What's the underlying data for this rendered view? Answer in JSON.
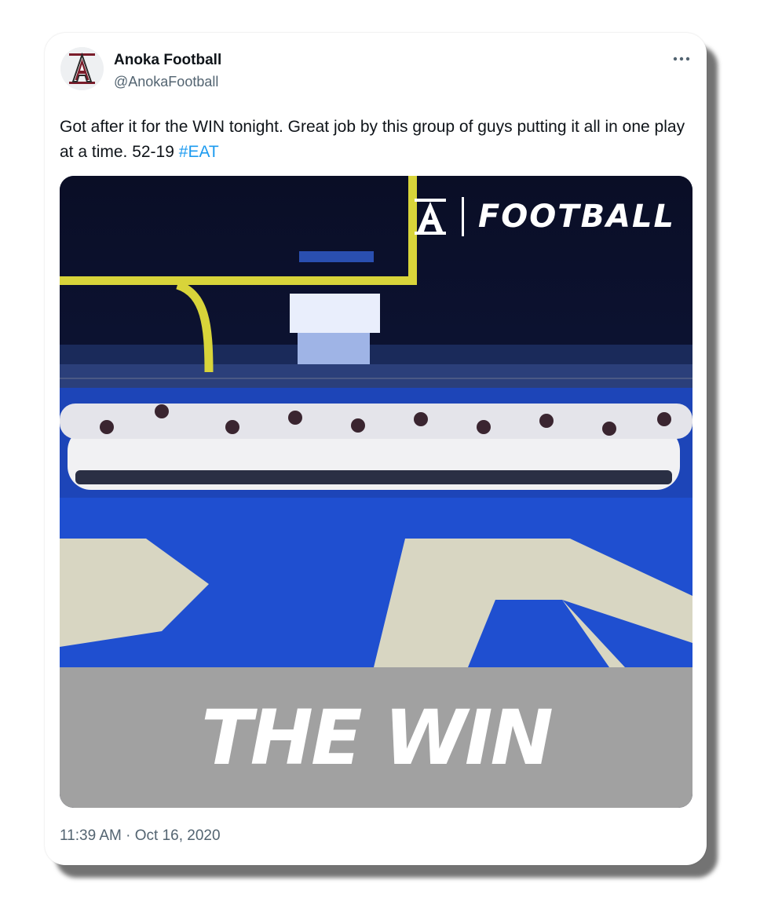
{
  "account": {
    "name": "Anoka Football",
    "handle": "@AnokaFootball",
    "avatar_icon": "anoka-a-logo-icon"
  },
  "tweet": {
    "text": "Got after it for the WIN tonight. Great job by this group of guys putting it all in one play at a time. 52-19",
    "hashtag": "#EAT",
    "timestamp": "11:39 AM · Oct 16, 2020"
  },
  "media": {
    "brand_text": "FOOTBALL",
    "banner_text": "THE WIN",
    "banner_color": "#a1a1a1",
    "field_color": "#1f4fd0",
    "sky_color": "#0a0f2a"
  },
  "icons": {
    "more": "more-options-icon"
  },
  "colors": {
    "text": "#0f1419",
    "secondary_text": "#536471",
    "link": "#1d9bf0"
  }
}
